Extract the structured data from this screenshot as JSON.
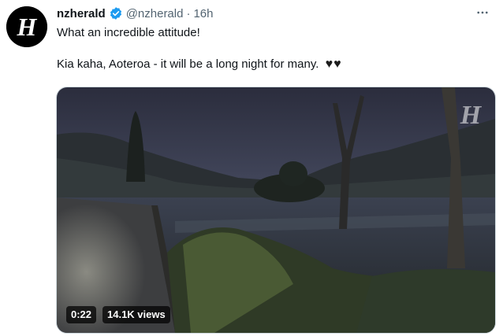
{
  "tweet": {
    "display_name": "nzherald",
    "handle": "@nzherald",
    "separator": "·",
    "time": "16h",
    "line1": "What an incredible attitude!",
    "line2": "Kia kaha, Aoteroa - it will be a long night for many.",
    "hearts": "♥♥",
    "avatar_letter": "H",
    "verified_color": "#1d9bf0",
    "more_icon": "more-horizontal-icon"
  },
  "video": {
    "duration": "0:22",
    "views": "14.1K views",
    "watermark_letter": "H"
  }
}
